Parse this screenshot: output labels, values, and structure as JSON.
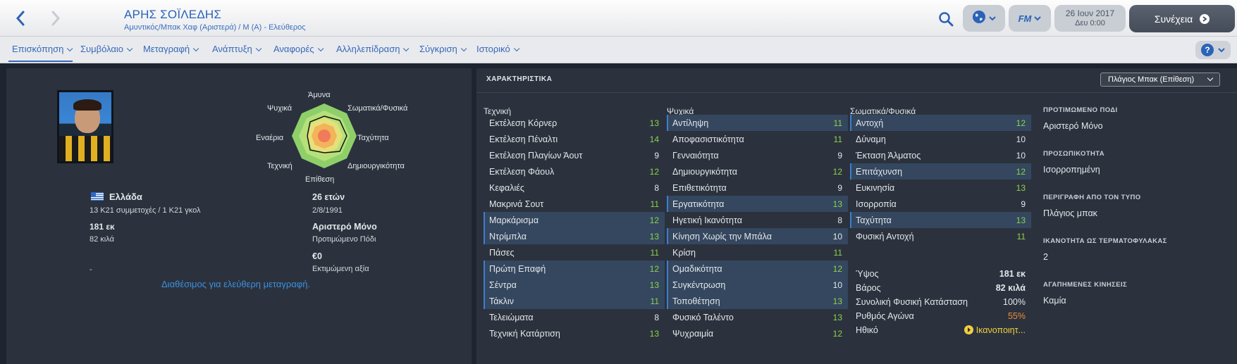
{
  "header": {
    "player_name": "ΑΡΗΣ ΣΟΪΛΕΔΗΣ",
    "player_sub": "Αμυντικός/Μπακ Χαφ (Αριστερά) / Μ (Α) - Ελεύθερος",
    "date": "26 Ιουν 2017",
    "time": "Δευ 0:00",
    "continue_label": "Συνέχεια",
    "fm_label": "FM",
    "icons": [
      "back-arrow-icon",
      "forward-arrow-icon",
      "search-icon",
      "globe-icon",
      "chevron-down-icon"
    ]
  },
  "tabs": [
    {
      "label": "Επισκόπηση"
    },
    {
      "label": "Συμβόλαιο"
    },
    {
      "label": "Μεταγραφή"
    },
    {
      "label": "Ανάπτυξη"
    },
    {
      "label": "Αναφορές"
    },
    {
      "label": "Αλληλεπίδραση"
    },
    {
      "label": "Σύγκριση"
    },
    {
      "label": "Ιστορικό"
    }
  ],
  "profile": {
    "nationality": "Ελλάδα",
    "caps": "13 Κ21 συμμετοχές / 1 Κ21 γκολ",
    "height": "181 εκ",
    "weight": "82 κιλά",
    "age": "26 ετών",
    "dob": "2/8/1991",
    "foot": "Αριστερό Μόνο",
    "foot_label": "Προτιμώμενο Πόδι",
    "value": "€0",
    "value_label": "Εκτιμώμενη αξία",
    "dash": "-",
    "transfer_link": "Διαθέσιμος για ελεύθερη μεταγραφή."
  },
  "radar": {
    "labels": {
      "top": "Άμυνα",
      "top_right": "Σωματικά/Φυσικά",
      "right": "Ταχύτητα",
      "bottom_right": "Δημιουργικότητα",
      "bottom": "Επίθεση",
      "bottom_left": "Τεχνική",
      "left": "Εναέρια",
      "top_left": "Ψυχικά"
    },
    "colors": [
      "#8fcf6a",
      "#b6e07a",
      "#e6e07a",
      "#f3b35a",
      "#f07a5a"
    ]
  },
  "attributes": {
    "title": "ΧΑΡΑΚΤΗΡΙΣΤΙΚΑ",
    "role": "Πλάγιος Μπακ (Επίθεση)",
    "technical_title": "Τεχνική",
    "mental_title": "Ψυχικά",
    "physical_title": "Σωματικά/Φυσικά",
    "technical": [
      {
        "name": "Εκτέλεση Κόρνερ",
        "value": "13",
        "hl": false
      },
      {
        "name": "Εκτέλεση Πέναλτι",
        "value": "14",
        "hl": false
      },
      {
        "name": "Εκτέλεση Πλαγίων Άουτ",
        "value": "9",
        "hl": false
      },
      {
        "name": "Εκτέλεση Φάουλ",
        "value": "12",
        "hl": false
      },
      {
        "name": "Κεφαλιές",
        "value": "8",
        "hl": false
      },
      {
        "name": "Μακρινά Σουτ",
        "value": "11",
        "hl": false
      },
      {
        "name": "Μαρκάρισμα",
        "value": "12",
        "hl": true
      },
      {
        "name": "Ντρίμπλα",
        "value": "13",
        "hl": true
      },
      {
        "name": "Πάσες",
        "value": "11",
        "hl": false
      },
      {
        "name": "Πρώτη Επαφή",
        "value": "12",
        "hl": true
      },
      {
        "name": "Σέντρα",
        "value": "13",
        "hl": true
      },
      {
        "name": "Τάκλιν",
        "value": "11",
        "hl": true
      },
      {
        "name": "Τελειώματα",
        "value": "8",
        "hl": false
      },
      {
        "name": "Τεχνική Κατάρτιση",
        "value": "13",
        "hl": false
      }
    ],
    "mental": [
      {
        "name": "Αντίληψη",
        "value": "11",
        "hl": true
      },
      {
        "name": "Αποφασιστικότητα",
        "value": "11",
        "hl": false
      },
      {
        "name": "Γενναιότητα",
        "value": "9",
        "hl": false
      },
      {
        "name": "Δημιουργικότητα",
        "value": "12",
        "hl": false
      },
      {
        "name": "Επιθετικότητα",
        "value": "9",
        "hl": false
      },
      {
        "name": "Εργατικότητα",
        "value": "13",
        "hl": true
      },
      {
        "name": "Ηγετική Ικανότητα",
        "value": "8",
        "hl": false
      },
      {
        "name": "Κίνηση Χωρίς την Μπάλα",
        "value": "10",
        "hl": true
      },
      {
        "name": "Κρίση",
        "value": "11",
        "hl": false
      },
      {
        "name": "Ομαδικότητα",
        "value": "12",
        "hl": true
      },
      {
        "name": "Συγκέντρωση",
        "value": "10",
        "hl": true
      },
      {
        "name": "Τοποθέτηση",
        "value": "13",
        "hl": true
      },
      {
        "name": "Φυσικό Ταλέντο",
        "value": "13",
        "hl": false
      },
      {
        "name": "Ψυχραιμία",
        "value": "12",
        "hl": false
      }
    ],
    "physical": [
      {
        "name": "Αντοχή",
        "value": "12",
        "hl": true
      },
      {
        "name": "Δύναμη",
        "value": "10",
        "hl": false
      },
      {
        "name": "Έκταση Άλματος",
        "value": "10",
        "hl": false
      },
      {
        "name": "Επιτάχυνση",
        "value": "12",
        "hl": true
      },
      {
        "name": "Ευκινησία",
        "value": "13",
        "hl": false
      },
      {
        "name": "Ισορροπία",
        "value": "9",
        "hl": false
      },
      {
        "name": "Ταχύτητα",
        "value": "13",
        "hl": true
      },
      {
        "name": "Φυσική Αντοχή",
        "value": "11",
        "hl": false
      }
    ],
    "physical_info": [
      {
        "name": "Ύψος",
        "value": "181 εκ",
        "style": "bold"
      },
      {
        "name": "Βάρος",
        "value": "82 κιλά",
        "style": "bold"
      },
      {
        "name": "Συνολική Φυσική Κατάσταση",
        "value": "100%",
        "style": "white"
      },
      {
        "name": "Ρυθμός Αγώνα",
        "value": "55%",
        "style": "orange"
      },
      {
        "name": "Ηθικό",
        "value": "Ικανοποιητ...",
        "style": "yellow"
      }
    ]
  },
  "side_info": [
    {
      "head": "ΠΡΟΤΙΜΩΜΕΝΟ ΠΟΔΙ",
      "value": "Αριστερό Μόνο"
    },
    {
      "head": "ΠΡΟΣΩΠΙΚΟΤΗΤΑ",
      "value": "Ισορροπημένη"
    },
    {
      "head": "ΠΕΡΙΓΡΑΦΗ ΑΠΟ ΤΟΝ ΤΥΠΟ",
      "value": "Πλάγιος μπακ"
    },
    {
      "head": "ΙΚΑΝΟΤΗΤΑ ΩΣ ΤΕΡΜΑΤΟΦΥΛΑΚΑΣ",
      "value": "2"
    },
    {
      "head": "ΑΓΑΠΗΜΕΝΕΣ ΚΙΝΗΣΕΙΣ",
      "value": "Καμία"
    }
  ]
}
